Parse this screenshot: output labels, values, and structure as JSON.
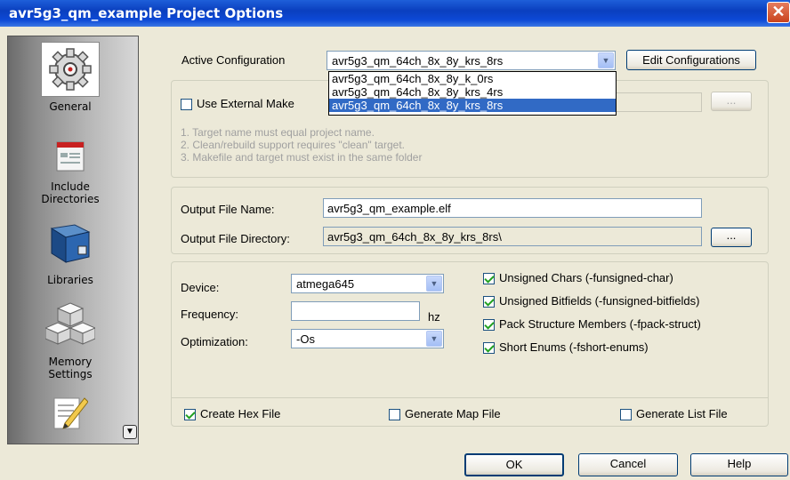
{
  "window": {
    "title": "avr5g3_qm_example Project Options",
    "close_glyph": "✕"
  },
  "sidebar": {
    "items": [
      {
        "label": "General",
        "icon": "gear-icon"
      },
      {
        "label": "Include\nDirectories",
        "icon": "folder-list-icon"
      },
      {
        "label": "Libraries",
        "icon": "library-book-icon"
      },
      {
        "label": "Memory\nSettings",
        "icon": "memory-blocks-icon"
      },
      {
        "label": "",
        "icon": "edit-notepad-icon"
      }
    ],
    "scroll_glyph": "▼"
  },
  "config": {
    "label": "Active Configuration",
    "value": "avr5g3_qm_64ch_8x_8y_krs_8rs",
    "edit_button": "Edit Configurations",
    "options": [
      "avr5g3_qm_64ch_8x_8y_k_0rs",
      "avr5g3_qm_64ch_8x_8y_krs_4rs",
      "avr5g3_qm_64ch_8x_8y_krs_8rs"
    ]
  },
  "makefile": {
    "checkbox_label": "Use External Make",
    "browse_label": "...",
    "notes": [
      "1. Target name must equal project name.",
      "2. Clean/rebuild support requires  \"clean\" target.",
      "3. Makefile and target must exist in the same folder"
    ]
  },
  "output": {
    "name_label": "Output File Name:",
    "name_value": "avr5g3_qm_example.elf",
    "dir_label": "Output File Directory:",
    "dir_value": "avr5g3_qm_64ch_8x_8y_krs_8rs\\",
    "browse_label": "..."
  },
  "device": {
    "device_label": "Device:",
    "device_value": "atmega645",
    "frequency_label": "Frequency:",
    "frequency_value": "",
    "frequency_unit": "hz",
    "optimization_label": "Optimization:",
    "optimization_value": "-Os"
  },
  "compiler_flags": [
    {
      "label": "Unsigned Chars (-funsigned-char)",
      "checked": true
    },
    {
      "label": "Unsigned Bitfields (-funsigned-bitfields)",
      "checked": true
    },
    {
      "label": "Pack Structure Members (-fpack-struct)",
      "checked": true
    },
    {
      "label": "Short Enums (-fshort-enums)",
      "checked": true
    }
  ],
  "outputs": {
    "hex_label": "Create Hex File",
    "hex_checked": true,
    "map_label": "Generate Map File",
    "map_checked": false,
    "list_label": "Generate List File",
    "list_checked": false
  },
  "buttons": {
    "ok": "OK",
    "cancel": "Cancel",
    "help": "Help"
  },
  "colors": {
    "title_bar": "#0a3fbf",
    "selection": "#316ac5",
    "dialog_bg": "#ece9d8"
  }
}
